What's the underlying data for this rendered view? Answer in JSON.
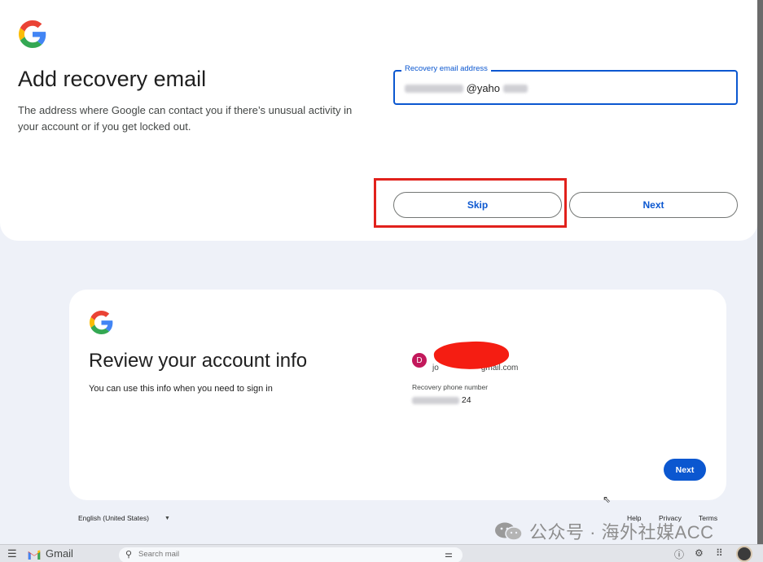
{
  "recovery": {
    "title": "Add recovery email",
    "description": "The address where Google can contact you if there’s unusual activity in your account or if you get locked out.",
    "field_label": "Recovery email address",
    "field_value_visible": "@yaho",
    "skip_label": "Skip",
    "next_label": "Next"
  },
  "review": {
    "title": "Review your account info",
    "description": "You can use this info when you need to sign in",
    "avatar_letter": "D",
    "account_email_visible": "jo",
    "account_email_suffix": "gmail.com",
    "phone_label": "Recovery phone number",
    "phone_visible": "24",
    "next_label": "Next"
  },
  "footer": {
    "language": "English (United States)",
    "links": [
      "Help",
      "Privacy",
      "Terms"
    ]
  },
  "watermark": {
    "text": "公众号 · 海外社媒ACC"
  },
  "taskbar": {
    "app_name": "Gmail",
    "search_placeholder": "Search mail"
  },
  "colors": {
    "accent": "#0b57d0",
    "highlight_box": "#e1211c",
    "redaction": "#f51d12",
    "avatar": "#c2185b"
  }
}
